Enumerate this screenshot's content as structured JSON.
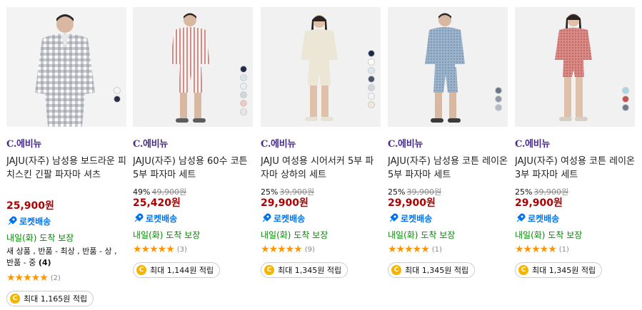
{
  "products": [
    {
      "brand": "C.에비뉴",
      "title": "JAJU(자주) 남성용 보드라운 피치스킨 긴팔 파자마 셔츠",
      "discount_pct": "",
      "orig_price": "",
      "price": "25,900원",
      "rocket": "로켓배송",
      "delivery": "내일(화) 도착 보장",
      "option_text": "새 상품 , 반품 - 최상 , 반품 - 상 , 반품 - 중",
      "option_count": "(4)",
      "stars": "★★★★★",
      "review_count": "(2)",
      "reward": "최대 1,165원 적립",
      "swatch_colors": [
        "#f5f5f5",
        "#2b2d42"
      ]
    },
    {
      "brand": "C.에비뉴",
      "title": "JAJU(자주) 남성용 60수 코튼 5부 파자마 세트",
      "discount_pct": "49%",
      "orig_price": "49,900원",
      "price": "25,420원",
      "rocket": "로켓배송",
      "delivery": "내일(화) 도착 보장",
      "stars": "★★★★★",
      "review_count": "(3)",
      "reward": "최대 1,144원 적립",
      "swatch_colors": [
        "#1e2a4a",
        "#d8e4ee",
        "#e9eef2",
        "#cfd6dc",
        "#f2c7c2",
        "#e6e6e6"
      ]
    },
    {
      "brand": "C.에비뉴",
      "title": "JAJU 여성용 시어서커 5부 파자마 상하의 세트",
      "discount_pct": "25%",
      "orig_price": "39,900원",
      "price": "29,900원",
      "rocket": "로켓배송",
      "delivery": "내일(화) 도착 보장",
      "stars": "★★★★★",
      "review_count": "(9)",
      "reward": "최대 1,345원 적립",
      "swatch_colors": [
        "#1e2a4a",
        "#ffffff",
        "#dfe7ee",
        "#4a5568",
        "#cfd6dc",
        "#f4f4f4",
        "#efe8d8"
      ]
    },
    {
      "brand": "C.에비뉴",
      "title": "JAJU(자주) 남성용 코튼 레이온 5부 파자마 세트",
      "discount_pct": "25%",
      "orig_price": "39,900원",
      "price": "29,900원",
      "rocket": "로켓배송",
      "delivery": "내일(화) 도착 보장",
      "stars": "★★★★★",
      "review_count": "(1)",
      "reward": "최대 1,345원 적립",
      "swatch_colors": [
        "#6b7785",
        "#8e99a4",
        "#b3bcc4"
      ]
    },
    {
      "brand": "C.에비뉴",
      "title": "JAJU(자주) 여성용 코튼 레이온 3부 파자마 세트",
      "discount_pct": "25%",
      "orig_price": "39,900원",
      "price": "29,900원",
      "rocket": "로켓배송",
      "delivery": "내일(화) 도착 보장",
      "stars": "★★★★★",
      "review_count": "(1)",
      "reward": "최대 1,345원 적립",
      "swatch_colors": [
        "#a9d7e8",
        "#c2534f",
        "#6f7a86"
      ]
    }
  ],
  "colors": {
    "price": "#ae0000",
    "rocket": "#0073e9",
    "delivery": "#008c00",
    "brand": "#4a2c8a",
    "star": "#ff9500",
    "coin": "#f5b400"
  }
}
